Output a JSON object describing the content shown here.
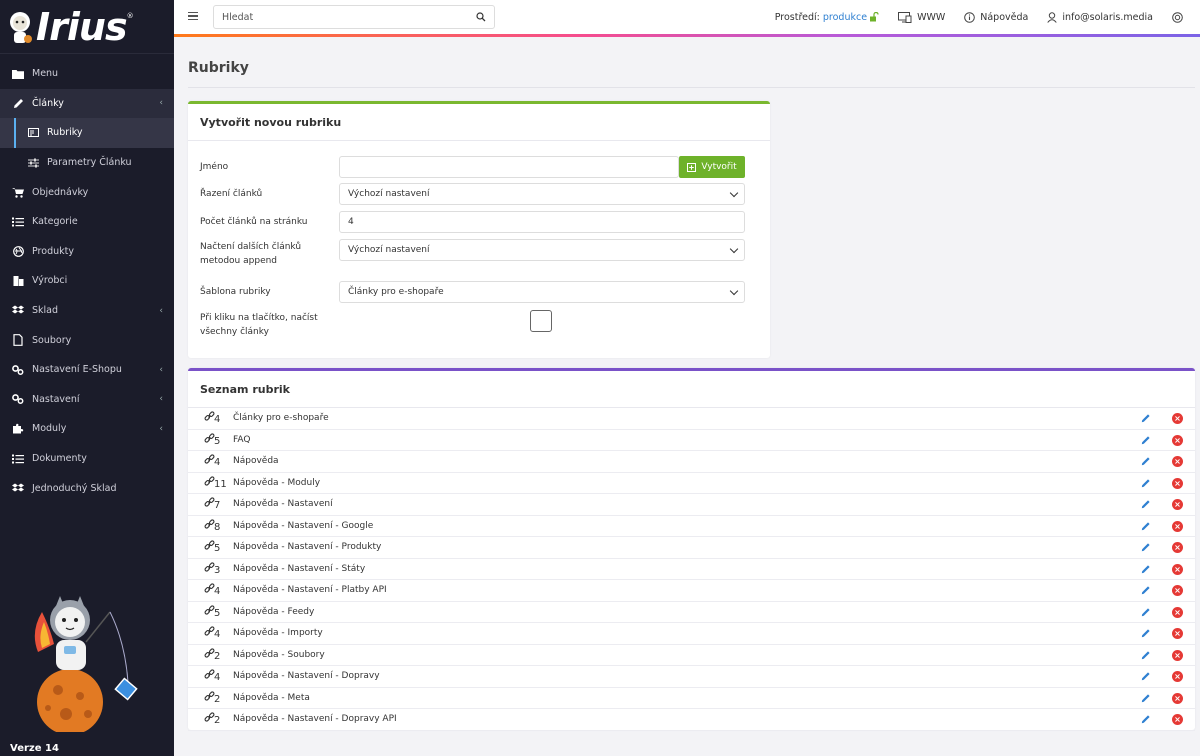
{
  "brand": {
    "logo_text": "Irius",
    "reg_mark": "®",
    "version": "Verze 14"
  },
  "sidebar": {
    "items": [
      {
        "label": "Menu",
        "icon": "folder-icon"
      },
      {
        "label": "Články",
        "icon": "pencil-icon",
        "expandable": true,
        "active": true
      },
      {
        "label": "Rubriky",
        "icon": "rubric-icon",
        "sub": true,
        "selected": true
      },
      {
        "label": "Parametry Článku",
        "icon": "sliders-icon",
        "sub": true
      },
      {
        "label": "Objednávky",
        "icon": "cart-icon"
      },
      {
        "label": "Kategorie",
        "icon": "list-icon"
      },
      {
        "label": "Produkty",
        "icon": "globe-icon"
      },
      {
        "label": "Výrobci",
        "icon": "building-icon"
      },
      {
        "label": "Sklad",
        "icon": "dropbox-icon",
        "expandable": true
      },
      {
        "label": "Soubory",
        "icon": "file-icon"
      },
      {
        "label": "Nastavení E-Shopu",
        "icon": "cogs-icon",
        "expandable": true
      },
      {
        "label": "Nastavení",
        "icon": "cogs-icon",
        "expandable": true
      },
      {
        "label": "Moduly",
        "icon": "puzzle-icon",
        "expandable": true
      },
      {
        "label": "Dokumenty",
        "icon": "list-icon"
      },
      {
        "label": "Jednoduchý Sklad",
        "icon": "dropbox-icon"
      }
    ]
  },
  "topbar": {
    "search_placeholder": "Hledat",
    "env_label": "Prostředí:",
    "env_value": "produkce",
    "www_label": "WWW",
    "help_label": "Nápověda",
    "user_label": "info@solaris.media",
    "accent_colors": [
      "#ff7a1a",
      "#f54c8f",
      "#b85ad8",
      "#7b63e6"
    ]
  },
  "page": {
    "title": "Rubriky"
  },
  "form": {
    "title": "Vytvořit novou rubriku",
    "name_label": "Jméno",
    "name_value": "",
    "create_button": "Vytvořit",
    "sort_label": "Řazení článků",
    "sort_value": "Výchozí nastavení",
    "per_page_label": "Počet článků na stránku",
    "per_page_value": "4",
    "append_label": "Načtení dalších článků metodou append",
    "append_value": "Výchozí nastavení",
    "template_label": "Šablona rubriky",
    "template_value": "Články pro e-shopaře",
    "load_all_label": "Při kliku na tlačítko, načíst všechny články",
    "load_all_checked": false
  },
  "list": {
    "title": "Seznam rubrik",
    "rows": [
      {
        "count": "4",
        "name": "Články pro e-shopaře"
      },
      {
        "count": "5",
        "name": "FAQ"
      },
      {
        "count": "4",
        "name": "Nápověda"
      },
      {
        "count": "11",
        "name": "Nápověda - Moduly"
      },
      {
        "count": "7",
        "name": "Nápověda - Nastavení"
      },
      {
        "count": "8",
        "name": "Nápověda - Nastavení - Google"
      },
      {
        "count": "5",
        "name": "Nápověda - Nastavení - Produkty"
      },
      {
        "count": "3",
        "name": "Nápověda - Nastavení - Státy"
      },
      {
        "count": "4",
        "name": "Nápověda - Nastavení - Platby API"
      },
      {
        "count": "5",
        "name": "Nápověda - Feedy"
      },
      {
        "count": "4",
        "name": "Nápověda - Importy"
      },
      {
        "count": "2",
        "name": "Nápověda - Soubory"
      },
      {
        "count": "4",
        "name": "Nápověda - Nastavení - Dopravy"
      },
      {
        "count": "2",
        "name": "Nápověda - Meta"
      },
      {
        "count": "2",
        "name": "Nápověda - Nastavení - Dopravy API"
      }
    ]
  },
  "colors": {
    "sidebar_bg": "#1b1c2a",
    "create_green": "#6eb22a",
    "edit_blue": "#2f80d1",
    "delete_red": "#e53935",
    "form_border": "#7ab82f",
    "list_border": "#7a52c8"
  }
}
